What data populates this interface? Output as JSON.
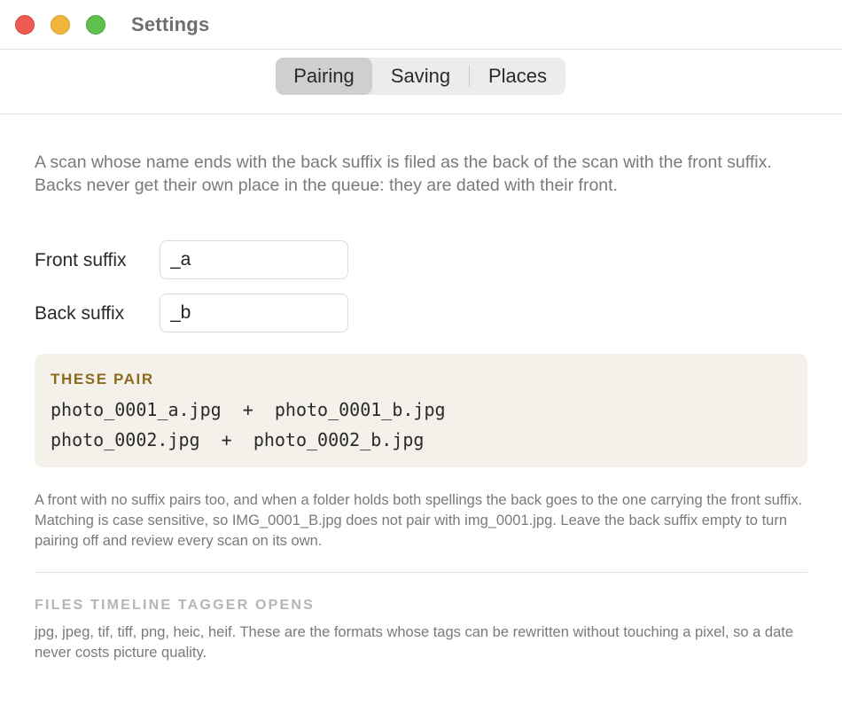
{
  "window": {
    "title": "Settings"
  },
  "tabs": [
    {
      "label": "Pairing",
      "active": true
    },
    {
      "label": "Saving",
      "active": false
    },
    {
      "label": "Places",
      "active": false
    }
  ],
  "pairing": {
    "intro": "A scan whose name ends with the back suffix is filed as the back of the scan with the front suffix. Backs never get their own place in the queue: they are dated with their front.",
    "front_label": "Front suffix",
    "front_value": "_a",
    "back_label": "Back suffix",
    "back_value": "_b",
    "example_heading": "THESE PAIR",
    "examples": [
      {
        "front": "photo_0001_a.jpg",
        "plus": "+",
        "back": "photo_0001_b.jpg"
      },
      {
        "front": "photo_0002.jpg",
        "plus": "+",
        "back": "photo_0002_b.jpg"
      }
    ],
    "note": "A front with no suffix pairs too, and when a folder holds both spellings the back goes to the one carrying the front suffix. Matching is case sensitive, so IMG_0001_B.jpg does not pair with img_0001.jpg. Leave the back suffix empty to turn pairing off and review every scan on its own."
  },
  "files": {
    "heading": "FILES TIMELINE TAGGER OPENS",
    "text": "jpg, jpeg, tif, tiff, png, heic, heif. These are the formats whose tags can be rewritten without touching a pixel, so a date never costs picture quality."
  },
  "colors": {
    "close": "#ee5b52",
    "minimize": "#f2b53c",
    "zoom": "#5ec14d",
    "accent_heading": "#8c6a1f",
    "example_bg": "#f4f1ea"
  }
}
